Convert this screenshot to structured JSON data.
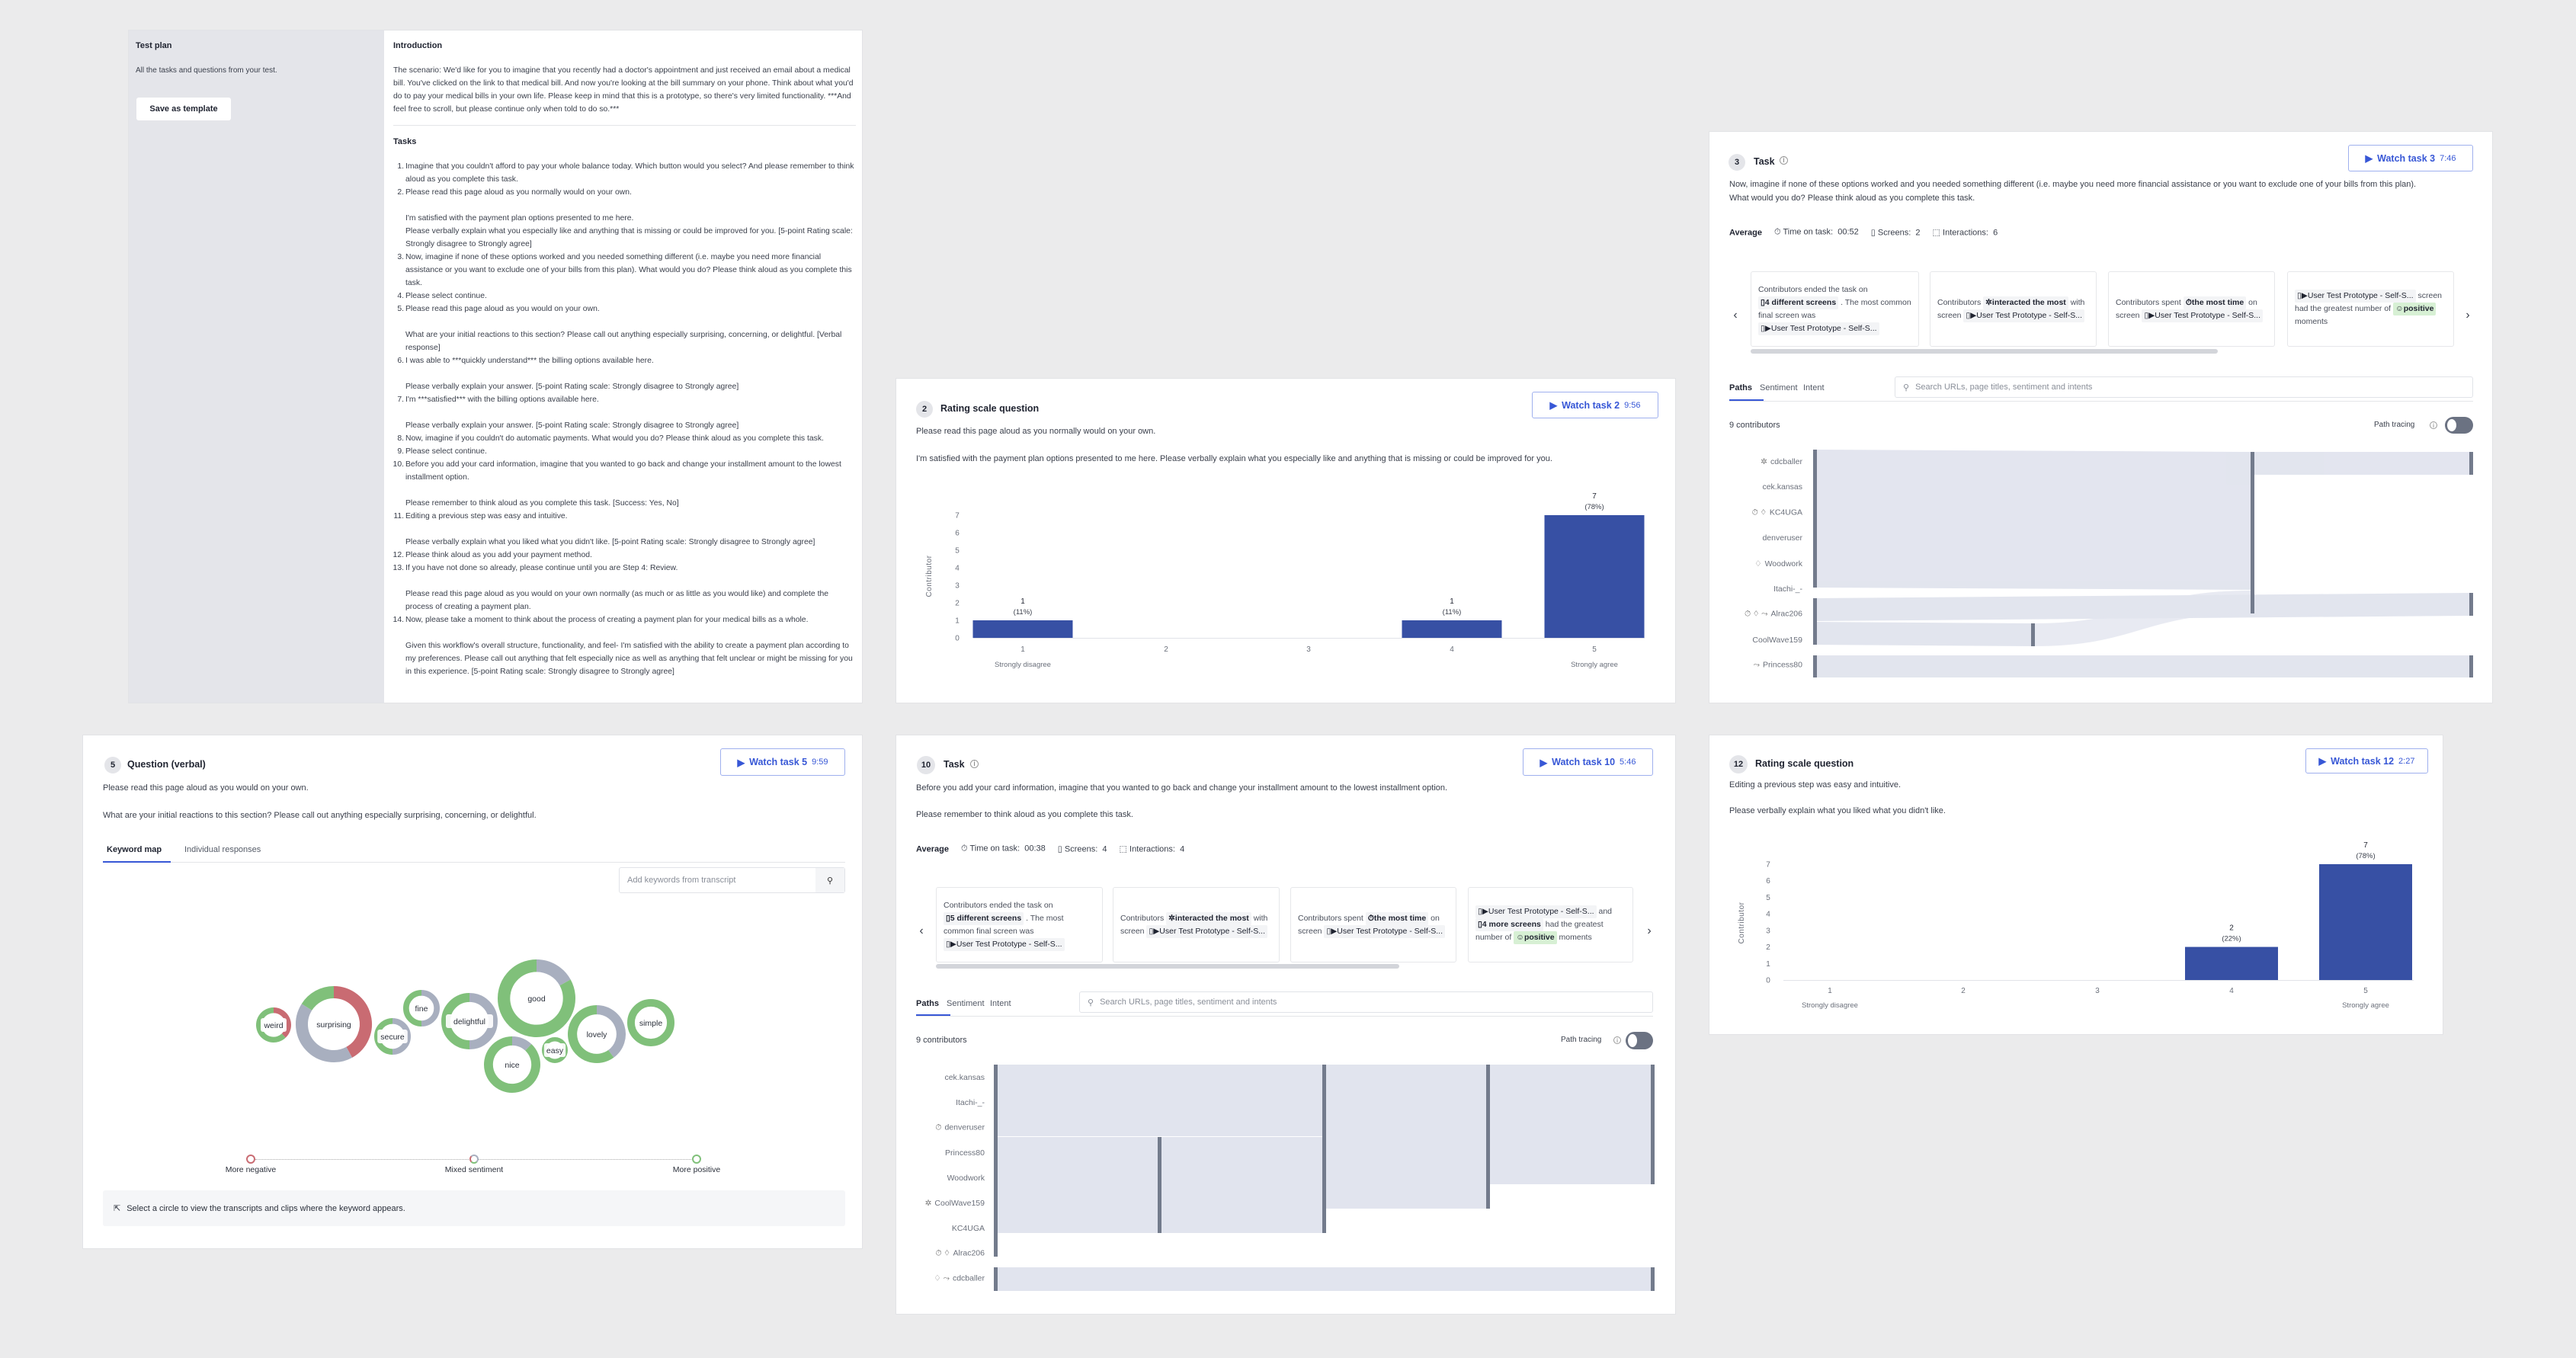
{
  "test_plan": {
    "title": "Test plan",
    "subtitle": "All the tasks and questions from your test.",
    "save_label": "Save as template",
    "intro_heading": "Introduction",
    "intro_text": "The scenario: We'd like for you to imagine that you recently had a doctor's appointment and just received an email about a medical bill. You've clicked on the link to that medical bill. And now you're looking at the bill summary on your phone. Think about what you'd do to pay your medical bills in your own life. Please keep in mind that this is a prototype, so there's very limited functionality. ***And feel free to scroll, but please continue only when told to do so.***",
    "tasks_heading": "Tasks",
    "tasks": [
      {
        "num": "1.",
        "paras": [
          "Imagine that you couldn't afford to pay your whole balance today. Which button would you select? And please remember to think aloud as you complete this task."
        ]
      },
      {
        "num": "2.",
        "paras": [
          "Please read this page aloud as you normally would on your own.",
          "I'm satisfied with the payment plan options presented to me here.\nPlease verbally explain what you especially like and anything that is missing or could be improved for you. [5-point Rating scale: Strongly disagree to Strongly agree]"
        ]
      },
      {
        "num": "3.",
        "paras": [
          "Now, imagine if none of these options worked and you needed something different (i.e. maybe you need more financial assistance or you want to exclude one of your bills from this plan). What would you do? Please think aloud as you complete this task."
        ]
      },
      {
        "num": "4.",
        "paras": [
          "Please select continue."
        ]
      },
      {
        "num": "5.",
        "paras": [
          "Please read this page aloud as you would on your own.",
          "What are your initial reactions to this section? Please call out anything especially surprising, concerning, or delightful. [Verbal response]"
        ]
      },
      {
        "num": "6.",
        "paras": [
          "I was able to ***quickly understand*** the billing options available here.",
          "Please verbally explain your answer.  [5-point Rating scale: Strongly disagree to Strongly agree]"
        ]
      },
      {
        "num": "7.",
        "paras": [
          "I'm ***satisfied*** with the billing options available here.",
          "Please verbally explain your answer.  [5-point Rating scale: Strongly disagree to Strongly agree]"
        ]
      },
      {
        "num": "8.",
        "paras": [
          "Now, imagine if you couldn't do automatic payments. What would you do? Please think aloud as you complete this task."
        ]
      },
      {
        "num": "9.",
        "paras": [
          "Please select continue."
        ]
      },
      {
        "num": "10.",
        "paras": [
          "Before you add your card information, imagine that you wanted to go back and change your installment amount to the lowest installment option.",
          "Please remember to think aloud as you complete this task. [Success: Yes, No]"
        ]
      },
      {
        "num": "11.",
        "paras": [
          "Editing a previous step was easy and intuitive.",
          "Please verbally explain what you liked what you didn't like.  [5-point Rating scale: Strongly disagree to Strongly agree]"
        ]
      },
      {
        "num": "12.",
        "paras": [
          "Please think aloud as you add your payment method."
        ]
      },
      {
        "num": "13.",
        "paras": [
          "If you have not done so already, please continue until you are Step 4: Review.",
          "Please read this page aloud as you would on your own normally (as much or as little as you would like) and complete the process of creating a payment plan."
        ]
      },
      {
        "num": "14.",
        "paras": [
          "Now, please take a moment to think about the process of creating a payment plan for your medical bills as a whole.",
          "Given this workflow's overall structure, functionality, and feel- I'm satisfied with the ability to create a payment plan according to my preferences. Please call out anything that felt especially nice as well as anything that felt unclear or might be missing for you in this experience. [5-point Rating scale: Strongly disagree to Strongly agree]"
        ]
      }
    ]
  },
  "rating2": {
    "number": "2",
    "title": "Rating scale question",
    "watch_label": "Watch task 2",
    "watch_duration": "9:56",
    "line1": "Please read this page aloud as you normally would on your own.",
    "line2": "I'm satisfied with the payment plan options presented to me here. Please verbally explain what you especially like and anything that is missing or could be improved for you."
  },
  "task3": {
    "number": "3",
    "title": "Task",
    "watch_label": "Watch task 3",
    "watch_duration": "7:46",
    "line1": "Now, imagine if none of these options worked and you needed something different (i.e. maybe you need more financial assistance or you want to exclude one of your bills from this plan).",
    "line2": "What would you do? Please think aloud as you complete this task.",
    "stats": {
      "label": "Average",
      "time_label": "Time on task:",
      "time": "00:52",
      "screens_label": "Screens:",
      "screens": "2",
      "interactions_label": "Interactions:",
      "interactions": "6"
    },
    "cards": [
      {
        "parts": [
          {
            "t": "Contributors ended the task on "
          },
          {
            "chip": "4 different screens",
            "icon": "▯"
          },
          {
            "t": " . The most common final screen was "
          },
          {
            "chip": "User Test Prototype - Self-S...",
            "icon": "▯▶",
            "norm": true
          }
        ]
      },
      {
        "parts": [
          {
            "t": "Contributors "
          },
          {
            "chip": "interacted the most",
            "icon": "✲"
          },
          {
            "t": " with screen "
          },
          {
            "chip": "User Test Prototype - Self-S...",
            "icon": "▯▶",
            "norm": true
          }
        ]
      },
      {
        "parts": [
          {
            "t": "Contributors spent "
          },
          {
            "chip": "the most time",
            "icon": "⏱"
          },
          {
            "t": " on screen "
          },
          {
            "chip": "User Test Prototype - Self-S...",
            "icon": "▯▶",
            "norm": true
          }
        ]
      },
      {
        "parts": [
          {
            "chip": "User Test Prototype - Self-S...",
            "icon": "▯▶",
            "norm": true
          },
          {
            "t": " screen had the greatest number of "
          },
          {
            "chip": "positive",
            "icon": "☺",
            "pos": true
          },
          {
            "t": " moments"
          }
        ]
      }
    ],
    "tabs": [
      "Paths",
      "Sentiment",
      "Intent"
    ],
    "search_placeholder": "Search URLs, page titles, sentiment and intents",
    "contributors": "9 contributors",
    "path_tracing": "Path tracing",
    "path_tracing_on": false,
    "sankey_labels": [
      {
        "name": "cdcballer",
        "icons": "✲"
      },
      {
        "name": "cek.kansas",
        "icons": ""
      },
      {
        "name": "KC4UGA",
        "icons": "⏱ ♢"
      },
      {
        "name": "denveruser",
        "icons": ""
      },
      {
        "name": "Woodwork",
        "icons": "♢"
      },
      {
        "name": "Itachi-_-",
        "icons": ""
      },
      {
        "name": "Alrac206",
        "icons": "⏱ ♢ ⤳"
      },
      {
        "name": "CoolWave159",
        "icons": ""
      },
      {
        "name": "Princess80",
        "icons": "⤳"
      }
    ]
  },
  "question5": {
    "number": "5",
    "title": "Question (verbal)",
    "watch_label": "Watch task 5",
    "watch_duration": "9:59",
    "line1": "Please read this page aloud as you would on your own.",
    "line2": "What are your initial reactions to this section? Please call out anything especially surprising, concerning, or delightful.",
    "tabs": [
      "Keyword map",
      "Individual responses"
    ],
    "search_placeholder": "Add keywords from transcript",
    "keywords": [
      {
        "word": "weird",
        "negative": 0.38,
        "mixed": 0.0,
        "positive": 0.62
      },
      {
        "word": "surprising",
        "negative": 0.42,
        "mixed": 0.42,
        "positive": 0.16
      },
      {
        "word": "secure",
        "negative": 0,
        "mixed": 0.5,
        "positive": 0.5
      },
      {
        "word": "fine",
        "negative": 0,
        "mixed": 0.5,
        "positive": 0.5
      },
      {
        "word": "delightful",
        "negative": 0,
        "mixed": 0.5,
        "positive": 0.5
      },
      {
        "word": "good",
        "negative": 0,
        "mixed": 0.17,
        "positive": 0.83
      },
      {
        "word": "nice",
        "negative": 0,
        "mixed": 0.12,
        "positive": 0.88
      },
      {
        "word": "easy",
        "negative": 0,
        "mixed": 0,
        "positive": 1
      },
      {
        "word": "lovely",
        "negative": 0,
        "mixed": 0.4,
        "positive": 0.6
      },
      {
        "word": "simple",
        "negative": 0,
        "mixed": 0,
        "positive": 1
      }
    ],
    "legend": [
      "More negative",
      "Mixed sentiment",
      "More positive"
    ],
    "hint": "Select a circle to view the transcripts and clips where the keyword appears.",
    "colors": {
      "negative": "#c96b72",
      "mixed": "#a8afbf",
      "positive": "#80c07a"
    }
  },
  "task10": {
    "number": "10",
    "title": "Task",
    "watch_label": "Watch task 10",
    "watch_duration": "5:46",
    "line1": "Before you add your card information, imagine that you wanted to go back and change your installment amount to the lowest installment option.",
    "line2": "Please remember to think aloud as you complete this task.",
    "stats": {
      "label": "Average",
      "time_label": "Time on task:",
      "time": "00:38",
      "screens_label": "Screens:",
      "screens": "4",
      "interactions_label": "Interactions:",
      "interactions": "4"
    },
    "cards": [
      {
        "parts": [
          {
            "t": "Contributors ended the task on "
          },
          {
            "chip": "5 different screens",
            "icon": "▯"
          },
          {
            "t": " . The most common final screen was "
          },
          {
            "chip": "User Test Prototype - Self-S...",
            "icon": "▯▶",
            "norm": true
          }
        ]
      },
      {
        "parts": [
          {
            "t": "Contributors "
          },
          {
            "chip": "interacted the most",
            "icon": "✲"
          },
          {
            "t": " with screen "
          },
          {
            "chip": "User Test Prototype - Self-S...",
            "icon": "▯▶",
            "norm": true
          }
        ]
      },
      {
        "parts": [
          {
            "t": "Contributors spent "
          },
          {
            "chip": "the most time",
            "icon": "⏱"
          },
          {
            "t": " on screen "
          },
          {
            "chip": "User Test Prototype - Self-S...",
            "icon": "▯▶",
            "norm": true
          }
        ]
      },
      {
        "parts": [
          {
            "chip": "User Test Prototype - Self-S...",
            "icon": "▯▶",
            "norm": true
          },
          {
            "t": " and "
          },
          {
            "chip": "4 more screens",
            "icon": "▯"
          },
          {
            "t": " had the greatest number of "
          },
          {
            "chip": "positive",
            "icon": "☺",
            "pos": true
          },
          {
            "t": " moments"
          }
        ]
      }
    ],
    "tabs": [
      "Paths",
      "Sentiment",
      "Intent"
    ],
    "search_placeholder": "Search URLs, page titles, sentiment and intents",
    "contributors": "9 contributors",
    "path_tracing": "Path tracing",
    "path_tracing_on": false,
    "sankey_labels": [
      {
        "name": "cek.kansas",
        "icons": ""
      },
      {
        "name": "Itachi-_-",
        "icons": ""
      },
      {
        "name": "denveruser",
        "icons": "⏱"
      },
      {
        "name": "Princess80",
        "icons": ""
      },
      {
        "name": "Woodwork",
        "icons": ""
      },
      {
        "name": "CoolWave159",
        "icons": "✲"
      },
      {
        "name": "KC4UGA",
        "icons": ""
      },
      {
        "name": "Alrac206",
        "icons": "⏱ ♢"
      },
      {
        "name": "cdcballer",
        "icons": "♢ ⤳"
      }
    ]
  },
  "rating12": {
    "number": "12",
    "title": "Rating scale question",
    "watch_label": "Watch task 12",
    "watch_duration": "2:27",
    "line1": "Editing a previous step was easy and intuitive.",
    "line2": "Please verbally explain what you liked what you didn't like."
  },
  "chart_data": [
    {
      "type": "bar",
      "categories": [
        "1",
        "2",
        "3",
        "4",
        "5"
      ],
      "category_sublabels": [
        "Strongly disagree",
        "",
        "",
        "",
        "Strongly agree"
      ],
      "values": [
        1,
        0,
        0,
        1,
        7
      ],
      "value_labels": [
        "(11%)",
        "",
        "",
        "(11%)",
        "(78%)"
      ],
      "ylabel": "Contributor",
      "yticks": [
        "0",
        "1",
        "2",
        "3",
        "4",
        "5",
        "6",
        "7"
      ],
      "ylim": [
        0,
        7
      ],
      "grid": false,
      "color": "#3750a4"
    },
    {
      "type": "bar",
      "categories": [
        "1",
        "2",
        "3",
        "4",
        "5"
      ],
      "category_sublabels": [
        "Strongly disagree",
        "",
        "",
        "",
        "Strongly agree"
      ],
      "values": [
        0,
        0,
        0,
        2,
        7
      ],
      "value_labels": [
        "",
        "",
        "",
        "(22%)",
        "(78%)"
      ],
      "ylabel": "Contributor",
      "yticks": [
        "0",
        "1",
        "2",
        "3",
        "4",
        "5",
        "6",
        "7"
      ],
      "ylim": [
        0,
        7
      ],
      "grid": false,
      "color": "#3750a4"
    }
  ]
}
